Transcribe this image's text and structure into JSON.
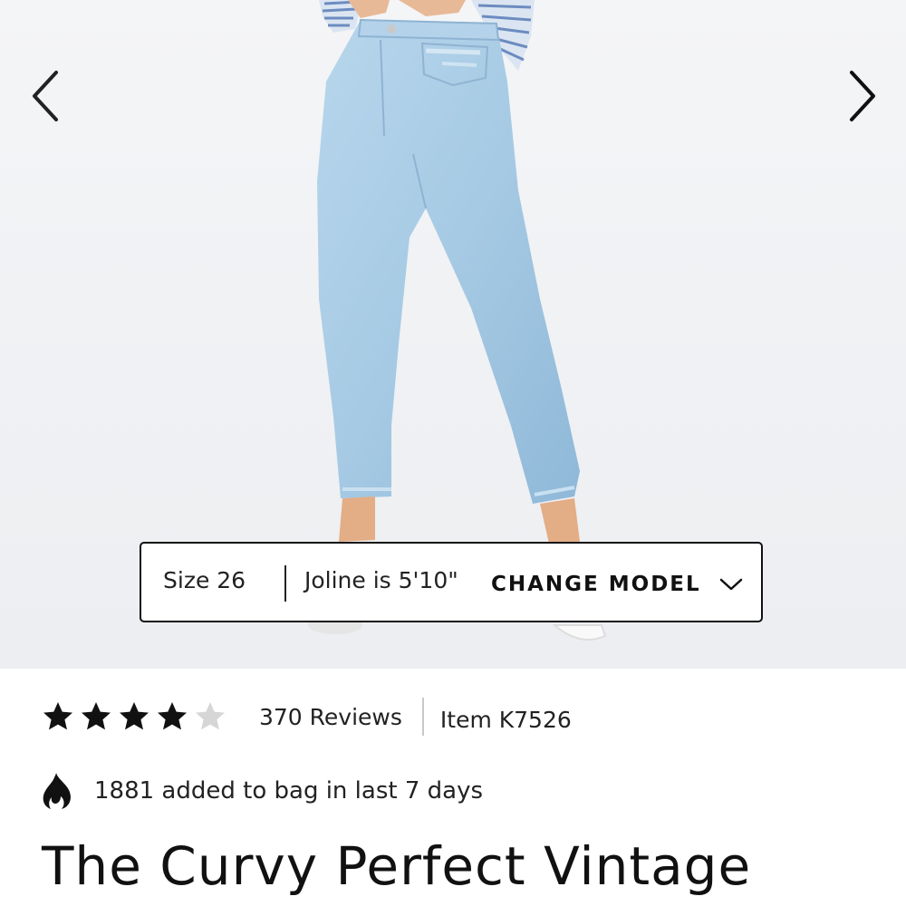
{
  "gallery": {
    "prev_icon": "chevron-left-icon",
    "next_icon": "chevron-right-icon",
    "background_color": "#f2f3f5",
    "denim_color": "#a9cde6"
  },
  "model_info": {
    "size_label": "Size 26",
    "height_label": "Joline is 5'10\"",
    "change_model_label": "CHANGE MODEL",
    "chevron_icon": "chevron-down-icon"
  },
  "rating": {
    "stars": 4,
    "max_stars": 5,
    "star_color": "#111111",
    "empty_star_color": "#d6d6d6",
    "reviews_label": "370 Reviews",
    "item_label": "Item K7526"
  },
  "social_proof": {
    "icon": "flame-icon",
    "text": "1881 added to bag in last 7 days"
  },
  "product": {
    "title": "The Curvy Perfect Vintage"
  }
}
